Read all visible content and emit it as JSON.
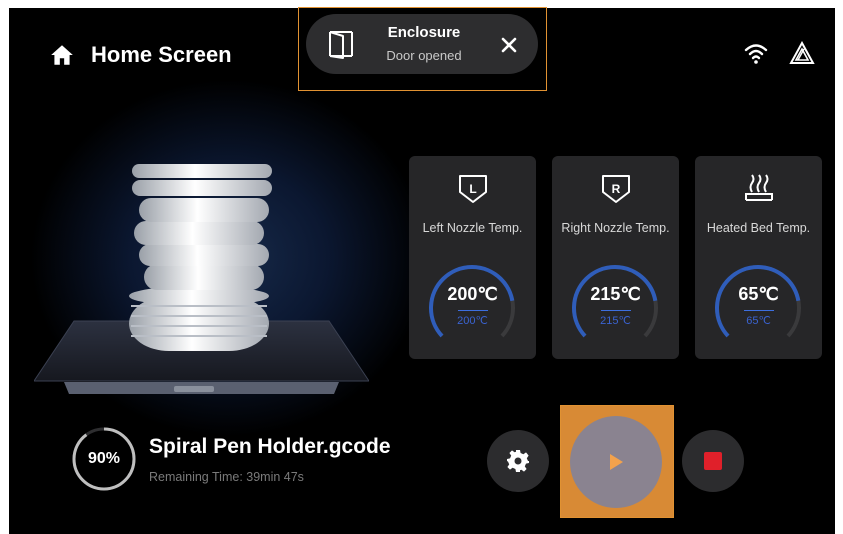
{
  "header": {
    "title": "Home Screen"
  },
  "notification": {
    "title": "Enclosure",
    "message": "Door opened"
  },
  "temperatures": [
    {
      "label": "Left Nozzle Temp.",
      "icon": "left-nozzle-icon",
      "current": "200℃",
      "target": "200℃",
      "level": 0.8
    },
    {
      "label": "Right Nozzle Temp.",
      "icon": "right-nozzle-icon",
      "current": "215℃",
      "target": "215℃",
      "level": 0.8
    },
    {
      "label": "Heated Bed Temp.",
      "icon": "heated-bed-icon",
      "current": "65℃",
      "target": "65℃",
      "level": 0.8
    }
  ],
  "job": {
    "progress_label": "90%",
    "progress": 0.9,
    "file_name": "Spiral Pen Holder.gcode",
    "remaining": "Remaining Time: 39min 47s"
  },
  "colors": {
    "accent": "#2f5dba",
    "highlight": "#e19232",
    "stop": "#e0202a",
    "card": "#262628"
  }
}
